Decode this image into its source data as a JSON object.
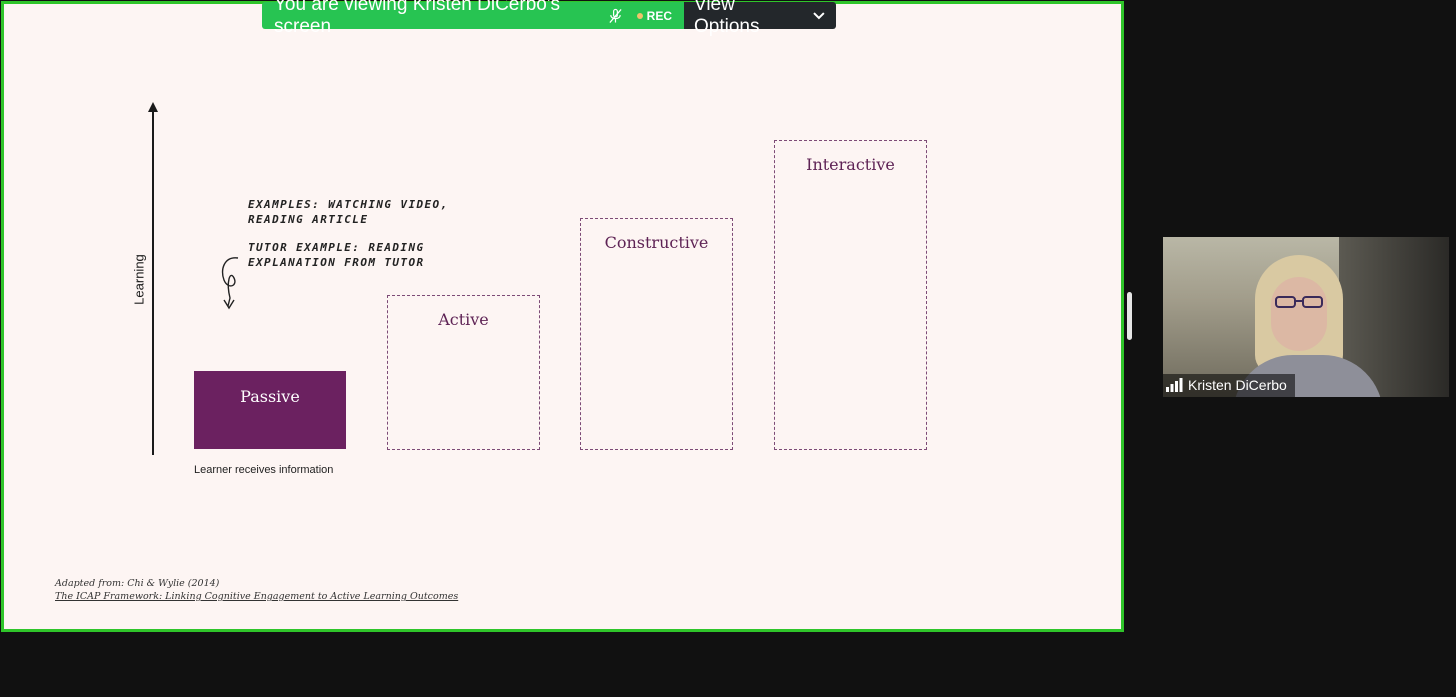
{
  "banner": {
    "viewing_text": "You are viewing Kristen DiCerbo's screen",
    "rec_label": "REC",
    "view_options_label": "View Options",
    "colors": {
      "banner_green": "#27c452",
      "view_options_bg": "#23272b",
      "share_border": "#2fc52a"
    }
  },
  "slide": {
    "axis_label": "Learning",
    "note_examples": "Examples: watching video, reading article",
    "note_tutor": "Tutor example: reading explanation from tutor",
    "bars": [
      {
        "label": "Passive"
      },
      {
        "label": "Active"
      },
      {
        "label": "Constructive"
      },
      {
        "label": "Interactive"
      }
    ],
    "passive_caption": "Learner receives information",
    "citation_line1": "Adapted from: Chi & Wylie (2014)",
    "citation_line2": "The ICAP Framework: Linking Cognitive Engagement to Active Learning Outcomes",
    "colors": {
      "background": "#fdf5f3",
      "accent": "#6b2160"
    }
  },
  "participant": {
    "name": "Kristen DiCerbo"
  }
}
